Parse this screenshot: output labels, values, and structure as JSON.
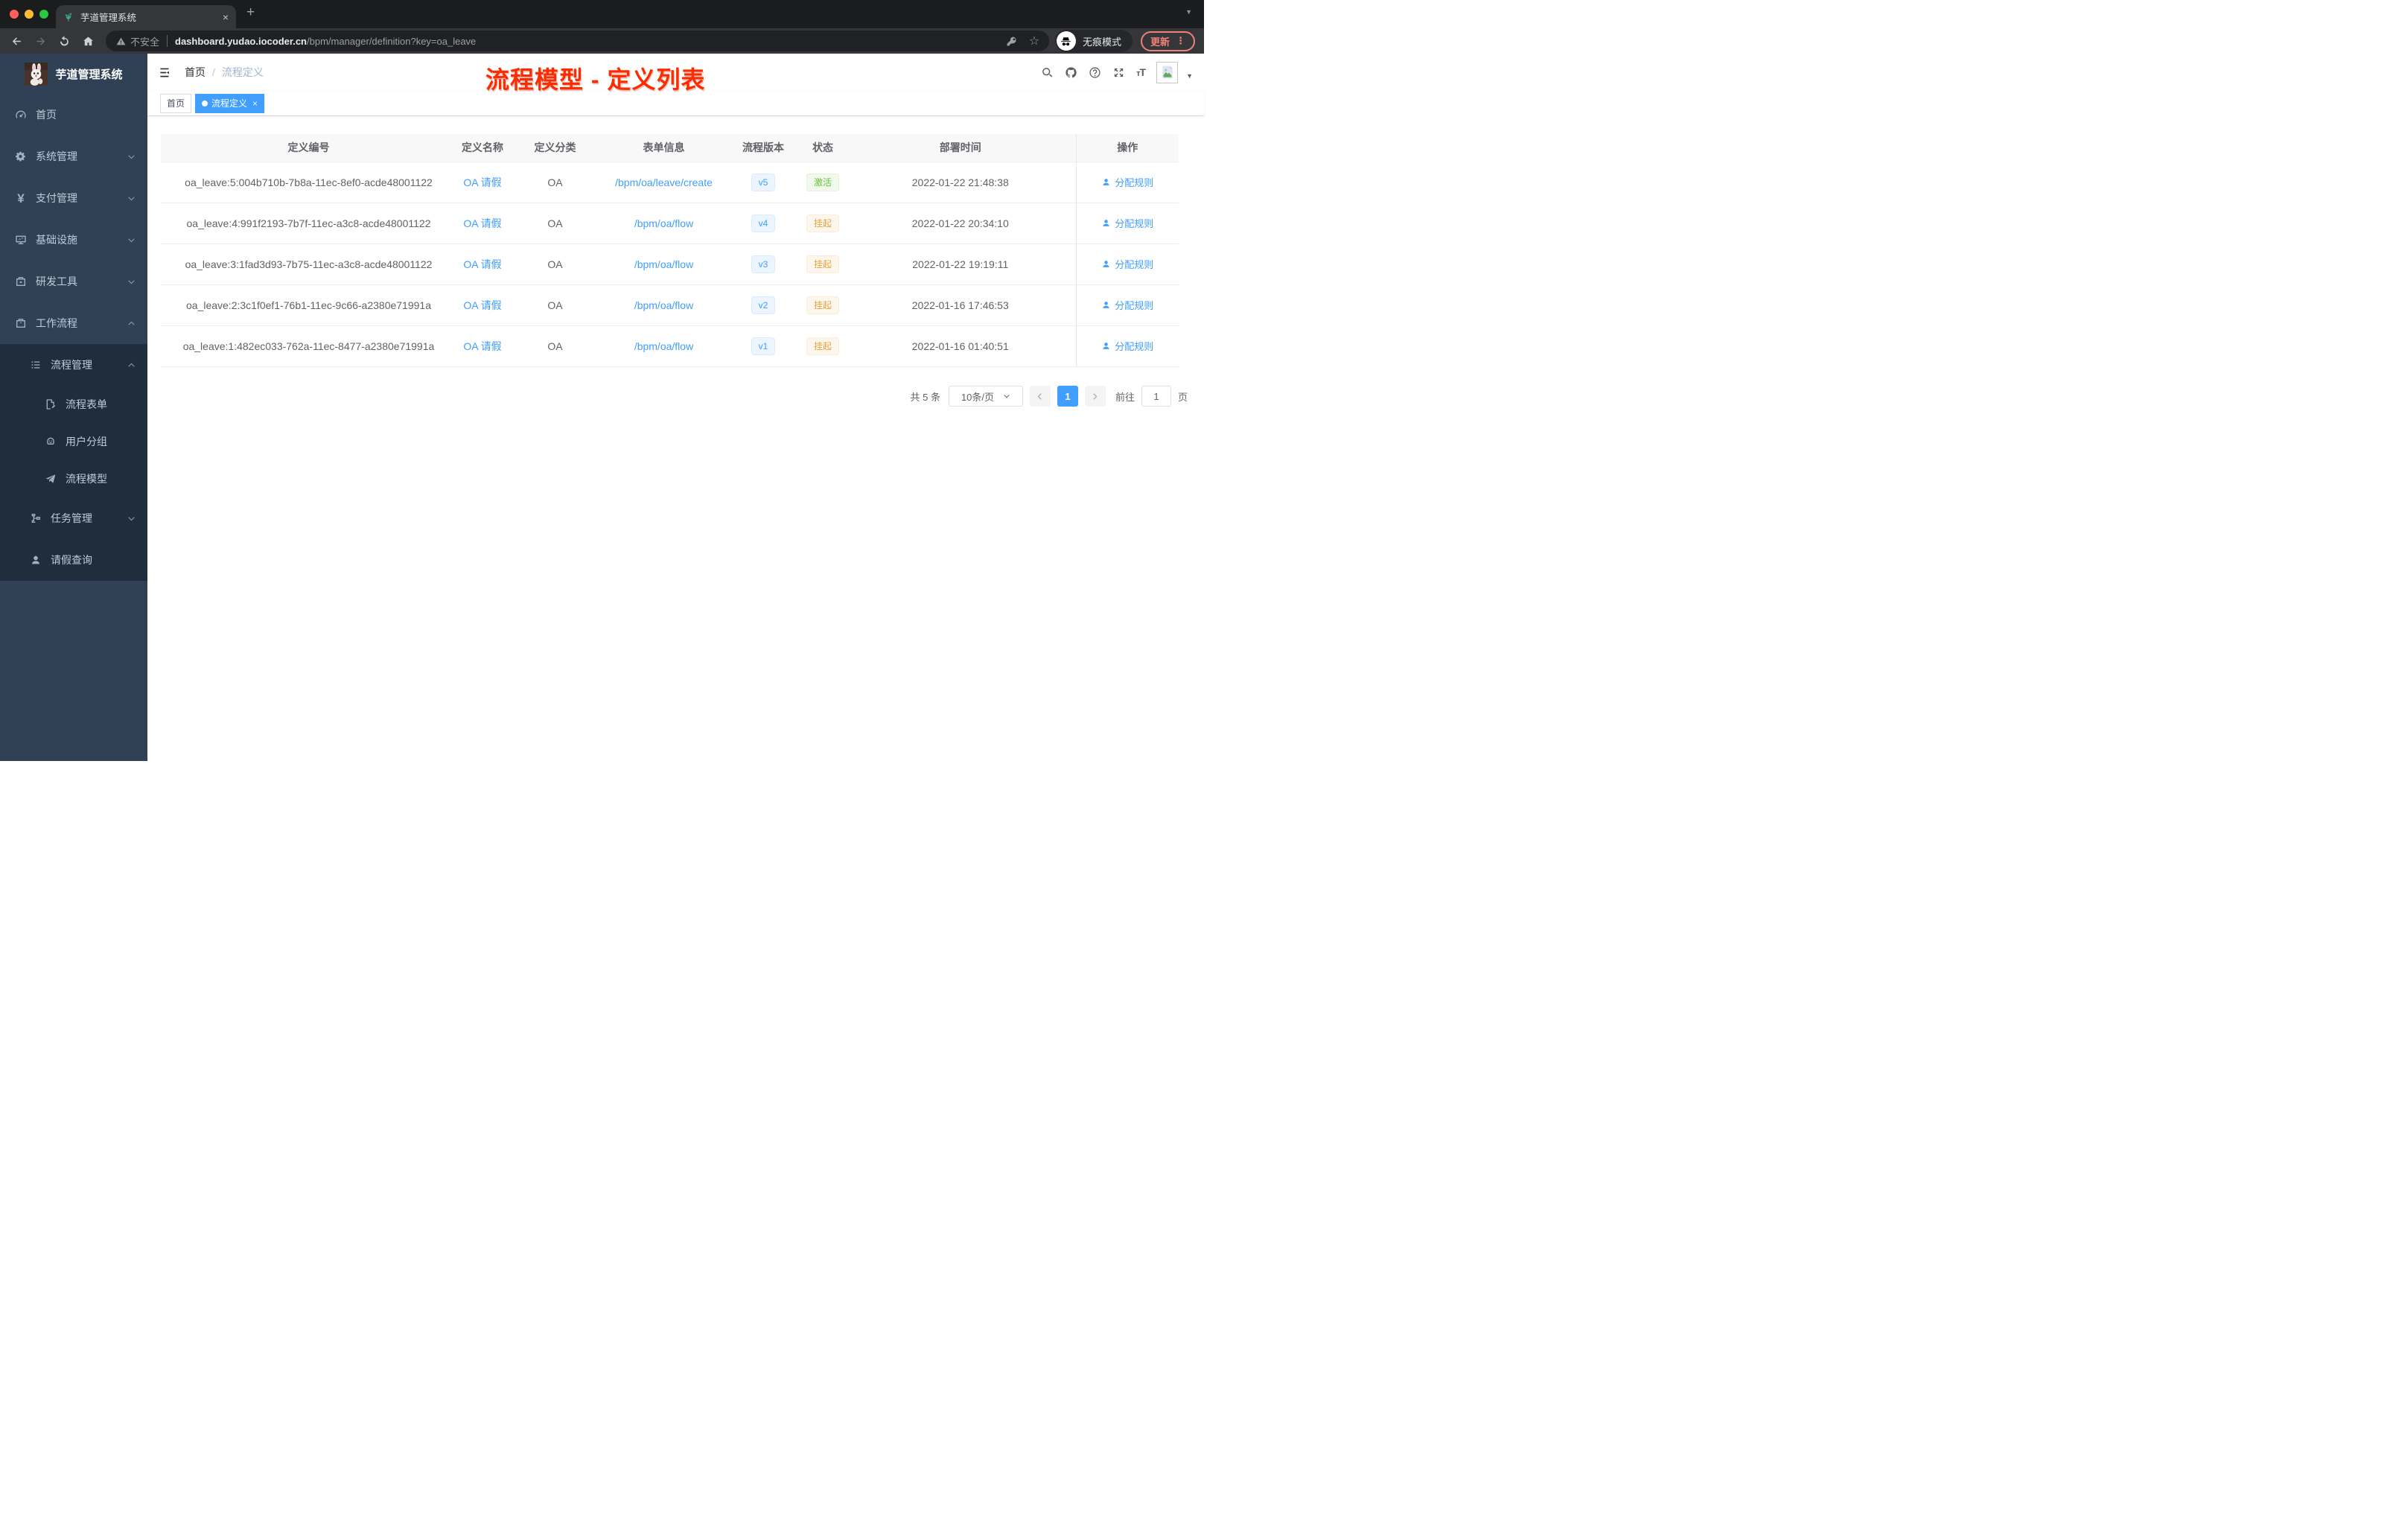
{
  "browser": {
    "tab_title": "芋道管理系统",
    "security_label": "不安全",
    "url_host": "dashboard.yudao.iocoder.cn",
    "url_path": "/bpm/manager/definition?key=oa_leave",
    "incognito_label": "无痕模式",
    "update_label": "更新"
  },
  "sidebar": {
    "title": "芋道管理系统",
    "items": [
      {
        "key": "home",
        "label": "首页",
        "icon": "dashboard-icon",
        "level": 1,
        "chevron": null,
        "dark": false
      },
      {
        "key": "system",
        "label": "系统管理",
        "icon": "gear-icon",
        "level": 1,
        "chevron": "down",
        "dark": false
      },
      {
        "key": "payment",
        "label": "支付管理",
        "icon": "yen-icon",
        "level": 1,
        "chevron": "down",
        "dark": false
      },
      {
        "key": "infrastructure",
        "label": "基础设施",
        "icon": "monitor-icon",
        "level": 1,
        "chevron": "down",
        "dark": false
      },
      {
        "key": "dev-tools",
        "label": "研发工具",
        "icon": "toolbox-icon",
        "level": 1,
        "chevron": "down",
        "dark": false
      },
      {
        "key": "workflow",
        "label": "工作流程",
        "icon": "briefcase-icon",
        "level": 1,
        "chevron": "up",
        "dark": false
      },
      {
        "key": "process-mgmt",
        "label": "流程管理",
        "icon": "list-icon",
        "level": 2,
        "chevron": "up",
        "dark": true
      },
      {
        "key": "process-form",
        "label": "流程表单",
        "icon": "form-icon",
        "level": 3,
        "chevron": null,
        "dark": true
      },
      {
        "key": "user-group",
        "label": "用户分组",
        "icon": "robot-icon",
        "level": 3,
        "chevron": null,
        "dark": true
      },
      {
        "key": "process-model",
        "label": "流程模型",
        "icon": "send-icon",
        "level": 3,
        "chevron": null,
        "dark": true
      },
      {
        "key": "task-mgmt",
        "label": "任务管理",
        "icon": "tree-icon",
        "level": 2,
        "chevron": "down",
        "dark": true
      },
      {
        "key": "leave-query",
        "label": "请假查询",
        "icon": "user-icon",
        "level": 2,
        "chevron": null,
        "dark": true
      }
    ]
  },
  "header": {
    "breadcrumb": [
      "首页",
      "流程定义"
    ],
    "annotation": "流程模型 - 定义列表",
    "icons": [
      "search-icon",
      "github-icon",
      "question-icon",
      "fullscreen-icon",
      "fontsize-icon"
    ]
  },
  "tags": [
    {
      "label": "首页",
      "active": false
    },
    {
      "label": "流程定义",
      "active": true
    }
  ],
  "table": {
    "headers": [
      "定义编号",
      "定义名称",
      "定义分类",
      "表单信息",
      "流程版本",
      "状态",
      "部署时间",
      "操作"
    ],
    "action_label": "分配规则",
    "rows": [
      {
        "id": "oa_leave:5:004b710b-7b8a-11ec-8ef0-acde48001122",
        "name": "OA 请假",
        "category": "OA",
        "form": "/bpm/oa/leave/create",
        "version": "v5",
        "status": "激活",
        "status_type": "success",
        "time": "2022-01-22 21:48:38"
      },
      {
        "id": "oa_leave:4:991f2193-7b7f-11ec-a3c8-acde48001122",
        "name": "OA 请假",
        "category": "OA",
        "form": "/bpm/oa/flow",
        "version": "v4",
        "status": "挂起",
        "status_type": "warning",
        "time": "2022-01-22 20:34:10"
      },
      {
        "id": "oa_leave:3:1fad3d93-7b75-11ec-a3c8-acde48001122",
        "name": "OA 请假",
        "category": "OA",
        "form": "/bpm/oa/flow",
        "version": "v3",
        "status": "挂起",
        "status_type": "warning",
        "time": "2022-01-22 19:19:11"
      },
      {
        "id": "oa_leave:2:3c1f0ef1-76b1-11ec-9c66-a2380e71991a",
        "name": "OA 请假",
        "category": "OA",
        "form": "/bpm/oa/flow",
        "version": "v2",
        "status": "挂起",
        "status_type": "warning",
        "time": "2022-01-16 17:46:53"
      },
      {
        "id": "oa_leave:1:482ec033-762a-11ec-8477-a2380e71991a",
        "name": "OA 请假",
        "category": "OA",
        "form": "/bpm/oa/flow",
        "version": "v1",
        "status": "挂起",
        "status_type": "warning",
        "time": "2022-01-16 01:40:51"
      }
    ]
  },
  "pagination": {
    "total": "共 5 条",
    "page_size": "10条/页",
    "active_page": "1",
    "goto_label": "前往",
    "goto_value": "1",
    "goto_suffix": "页"
  },
  "colors": {
    "accent": "#409eff",
    "sidebar_bg": "#304156",
    "submenu_bg": "#1f2d3d",
    "success": "#67c23a",
    "warning": "#e6a23c",
    "annotation_red": "#fd2c00"
  }
}
